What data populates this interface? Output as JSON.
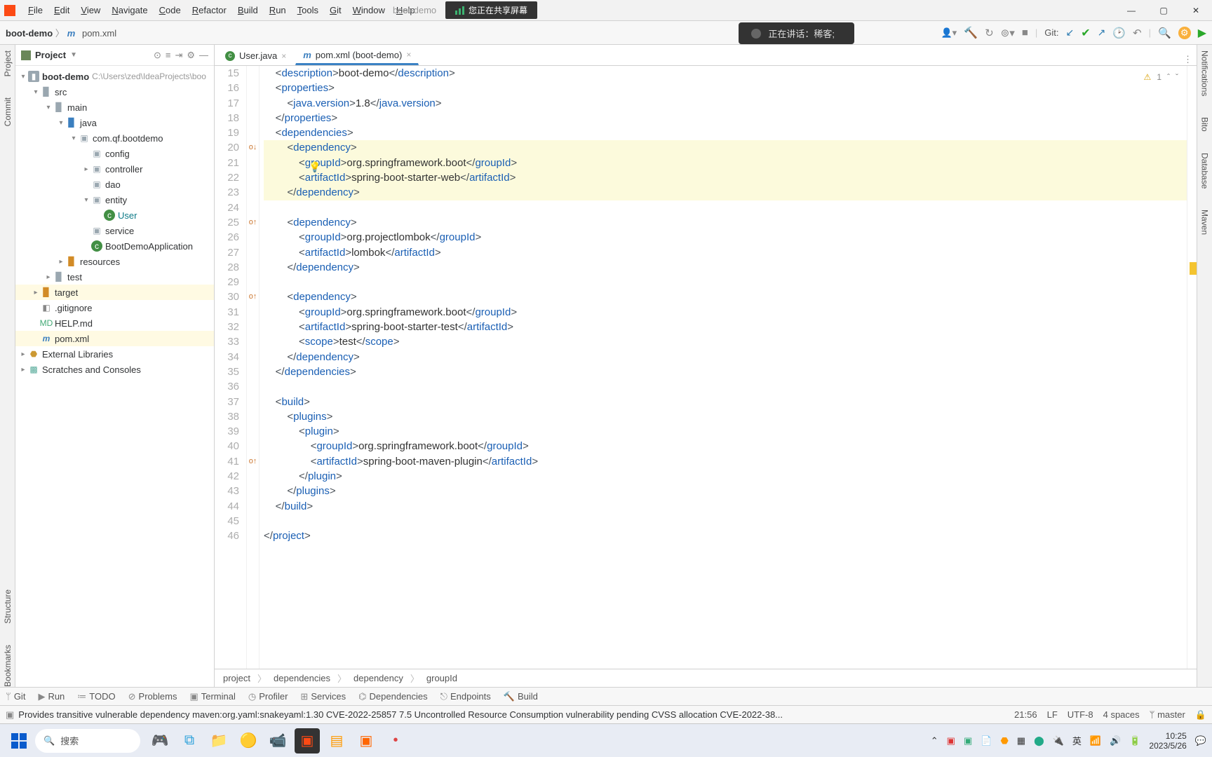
{
  "menu": {
    "items": [
      "File",
      "Edit",
      "View",
      "Navigate",
      "Code",
      "Refactor",
      "Build",
      "Run",
      "Tools",
      "Git",
      "Window",
      "Help"
    ],
    "brand": "boot-demo",
    "share": "您正在共享屏幕"
  },
  "speak": "正在讲话：稀客;",
  "nav": {
    "proj": "boot-demo",
    "file": "pom.xml",
    "git": "Git:"
  },
  "project": {
    "title": "Project",
    "root": "boot-demo",
    "rootPath": "C:\\Users\\zed\\IdeaProjects\\boo",
    "src": "src",
    "main": "main",
    "java": "java",
    "pkg": "com.qf.bootdemo",
    "config": "config",
    "controller": "controller",
    "dao": "dao",
    "entity": "entity",
    "user": "User",
    "service": "service",
    "app": "BootDemoApplication",
    "resources": "resources",
    "test": "test",
    "target": "target",
    "gitignore": ".gitignore",
    "help": "HELP.md",
    "pom": "pom.xml",
    "ext": "External Libraries",
    "scratch": "Scratches and Consoles"
  },
  "tabs": {
    "t1": "User.java",
    "t2": "pom.xml (boot-demo)"
  },
  "inspect": {
    "warn": "1"
  },
  "code": {
    "start": 15,
    "lines": [
      {
        "n": 15,
        "s": "    <description>boot-demo</description>",
        "tags": [
          "description",
          "description"
        ]
      },
      {
        "n": 16,
        "s": "    <properties>",
        "tags": [
          "properties"
        ]
      },
      {
        "n": 17,
        "s": "        <java.version>1.8</java.version>",
        "tags": [
          "java.version",
          "java.version"
        ]
      },
      {
        "n": 18,
        "s": "    </properties>",
        "tags": [
          "properties"
        ]
      },
      {
        "n": 19,
        "s": "    <dependencies>",
        "tags": [
          "dependencies"
        ]
      },
      {
        "n": 20,
        "s": "        <dependency>",
        "tags": [
          "dependency"
        ],
        "hl": true,
        "mark": "o↓"
      },
      {
        "n": 21,
        "s": "            <groupId>org.springframework.boot</groupId>",
        "tags": [
          "groupId",
          "groupId"
        ],
        "hl": true,
        "sel": [
          12,
          20,
          42,
          52
        ]
      },
      {
        "n": 22,
        "s": "            <artifactId>spring-boot-starter-web</artifactId>",
        "tags": [
          "artifactId",
          "artifactId"
        ],
        "hl": true
      },
      {
        "n": 23,
        "s": "        </dependency>",
        "tags": [
          "dependency"
        ],
        "hl": true
      },
      {
        "n": 24,
        "s": ""
      },
      {
        "n": 25,
        "s": "        <dependency>",
        "tags": [
          "dependency"
        ],
        "mark": "o↑"
      },
      {
        "n": 26,
        "s": "            <groupId>org.projectlombok</groupId>",
        "tags": [
          "groupId",
          "groupId"
        ]
      },
      {
        "n": 27,
        "s": "            <artifactId>lombok</artifactId>",
        "tags": [
          "artifactId",
          "artifactId"
        ]
      },
      {
        "n": 28,
        "s": "        </dependency>",
        "tags": [
          "dependency"
        ]
      },
      {
        "n": 29,
        "s": ""
      },
      {
        "n": 30,
        "s": "        <dependency>",
        "tags": [
          "dependency"
        ],
        "mark": "o↑"
      },
      {
        "n": 31,
        "s": "            <groupId>org.springframework.boot</groupId>",
        "tags": [
          "groupId",
          "groupId"
        ]
      },
      {
        "n": 32,
        "s": "            <artifactId>spring-boot-starter-test</artifactId>",
        "tags": [
          "artifactId",
          "artifactId"
        ]
      },
      {
        "n": 33,
        "s": "            <scope>test</scope>",
        "tags": [
          "scope",
          "scope"
        ]
      },
      {
        "n": 34,
        "s": "        </dependency>",
        "tags": [
          "dependency"
        ]
      },
      {
        "n": 35,
        "s": "    </dependencies>",
        "tags": [
          "dependencies"
        ]
      },
      {
        "n": 36,
        "s": ""
      },
      {
        "n": 37,
        "s": "    <build>",
        "tags": [
          "build"
        ]
      },
      {
        "n": 38,
        "s": "        <plugins>",
        "tags": [
          "plugins"
        ]
      },
      {
        "n": 39,
        "s": "            <plugin>",
        "tags": [
          "plugin"
        ]
      },
      {
        "n": 40,
        "s": "                <groupId>org.springframework.boot</groupId>",
        "tags": [
          "groupId",
          "groupId"
        ]
      },
      {
        "n": 41,
        "s": "                <artifactId>spring-boot-maven-plugin</artifactId>",
        "tags": [
          "artifactId",
          "artifactId"
        ],
        "mark": "o↑"
      },
      {
        "n": 42,
        "s": "            </plugin>",
        "tags": [
          "plugin"
        ]
      },
      {
        "n": 43,
        "s": "        </plugins>",
        "tags": [
          "plugins"
        ]
      },
      {
        "n": 44,
        "s": "    </build>",
        "tags": [
          "build"
        ]
      },
      {
        "n": 45,
        "s": ""
      },
      {
        "n": 46,
        "s": "</project>",
        "tags": [
          "project"
        ]
      }
    ]
  },
  "crumbs": [
    "project",
    "dependencies",
    "dependency",
    "groupId"
  ],
  "bottom": [
    "Git",
    "Run",
    "TODO",
    "Problems",
    "Terminal",
    "Profiler",
    "Services",
    "Dependencies",
    "Endpoints",
    "Build"
  ],
  "status": {
    "msg": "Provides transitive vulnerable dependency maven:org.yaml:snakeyaml:1.30 CVE-2022-25857 7.5 Uncontrolled Resource Consumption vulnerability pending CVSS allocation CVE-2022-38...",
    "pos": "21:56",
    "lf": "LF",
    "enc": "UTF-8",
    "indent": "4 spaces",
    "branch": "master"
  },
  "left": [
    "Project",
    "Commit",
    "Structure",
    "Bookmarks"
  ],
  "right": [
    "Notifications",
    "Bito",
    "Database",
    "Maven"
  ],
  "task": {
    "search": "搜索",
    "ime": "英",
    "time": "10:25",
    "date": "2023/5/26"
  }
}
